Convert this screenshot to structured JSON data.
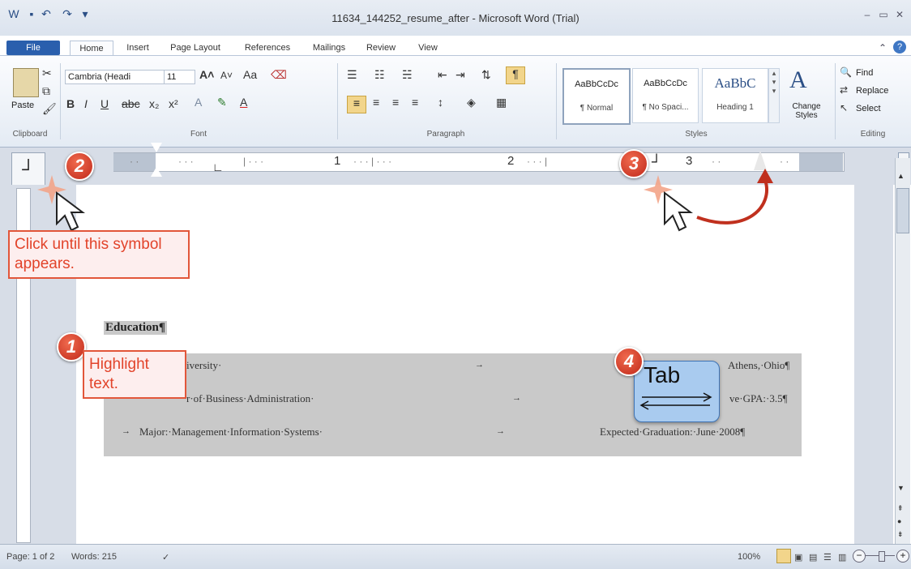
{
  "window": {
    "title": "11634_144252_resume_after - Microsoft Word (Trial)"
  },
  "ribbon_tabs": [
    "File",
    "Home",
    "Insert",
    "Page Layout",
    "References",
    "Mailings",
    "Review",
    "View"
  ],
  "clipboard": {
    "paste_label": "Paste",
    "group_label": "Clipboard"
  },
  "font": {
    "name": "Cambria (Headi",
    "size": "11",
    "group_label": "Font"
  },
  "paragraph": {
    "group_label": "Paragraph"
  },
  "styles": {
    "items": [
      {
        "sample": "AaBbCcDc",
        "name": "¶ Normal"
      },
      {
        "sample": "AaBbCcDc",
        "name": "¶ No Spaci..."
      },
      {
        "sample": "AaBbC",
        "name": "Heading 1"
      }
    ],
    "change_label": "Change Styles",
    "group_label": "Styles"
  },
  "editing": {
    "find": "Find",
    "replace": "Replace",
    "select": "Select",
    "group_label": "Editing"
  },
  "ruler": {
    "numbers": [
      "1",
      "2",
      "3"
    ]
  },
  "document": {
    "heading": "Education¶",
    "lines": [
      {
        "left": "iversity·",
        "right": "Athens,·Ohio¶"
      },
      {
        "left": "r·of·Business·Administration·",
        "right": "ve·GPA:·3.5¶"
      },
      {
        "left": "Major:·Management·Information·Systems·",
        "right": "Expected·Graduation:·June·2008¶"
      }
    ]
  },
  "callouts": {
    "step1": {
      "number": "1",
      "text": "Highlight text."
    },
    "step2": {
      "number": "2",
      "text": "Click until this symbol appears."
    },
    "step3": {
      "number": "3"
    },
    "step4": {
      "number": "4",
      "key_label": "Tab"
    }
  },
  "statusbar": {
    "page": "Page: 1 of 2",
    "words": "Words: 215",
    "zoom": "100%"
  }
}
